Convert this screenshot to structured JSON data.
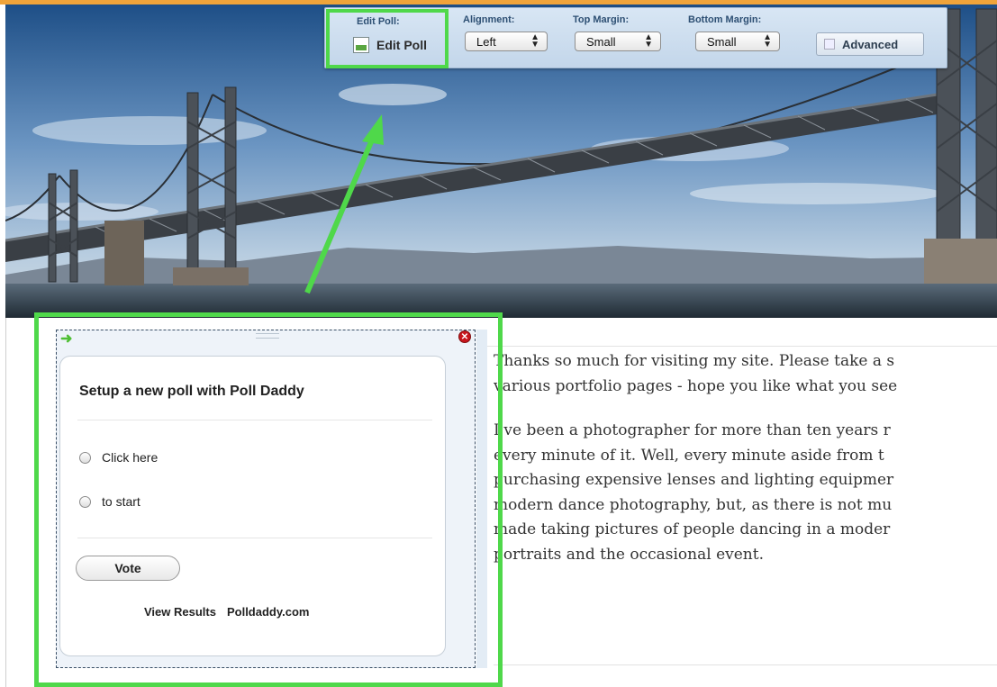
{
  "toolbar": {
    "edit_poll_label": "Edit Poll:",
    "edit_poll_button": "Edit Poll",
    "alignment_label": "Alignment:",
    "alignment_value": "Left",
    "top_margin_label": "Top Margin:",
    "top_margin_value": "Small",
    "bottom_margin_label": "Bottom Margin:",
    "bottom_margin_value": "Small",
    "advanced_label": "Advanced"
  },
  "poll": {
    "title": "Setup a new poll with Poll Daddy",
    "options": [
      "Click here",
      "to start"
    ],
    "vote_label": "Vote",
    "view_results": "View Results",
    "brand_link": "Polldaddy.com"
  },
  "content": {
    "paragraph1": [
      "Thanks so much for visiting my site.  Please take a s",
      "various portfolio pages - hope you like what you see"
    ],
    "paragraph2": [
      "I've been a photographer for more than ten years r",
      "every minute of it.  Well, every minute aside from t",
      "purchasing expensive lenses and lighting equipmer",
      "modern dance photography, but, as there is not mu",
      "made taking pictures of people dancing in a moder",
      "portraits and the occasional event."
    ]
  },
  "colors": {
    "highlight": "#4fd84a",
    "accent_bar": "#f0a43a",
    "toolbar_bg": "#c9dbee",
    "close_red": "#c8161d"
  },
  "icons": {
    "edit": "document-chart-icon",
    "move": "green-arrow-icon",
    "close": "close-icon"
  }
}
